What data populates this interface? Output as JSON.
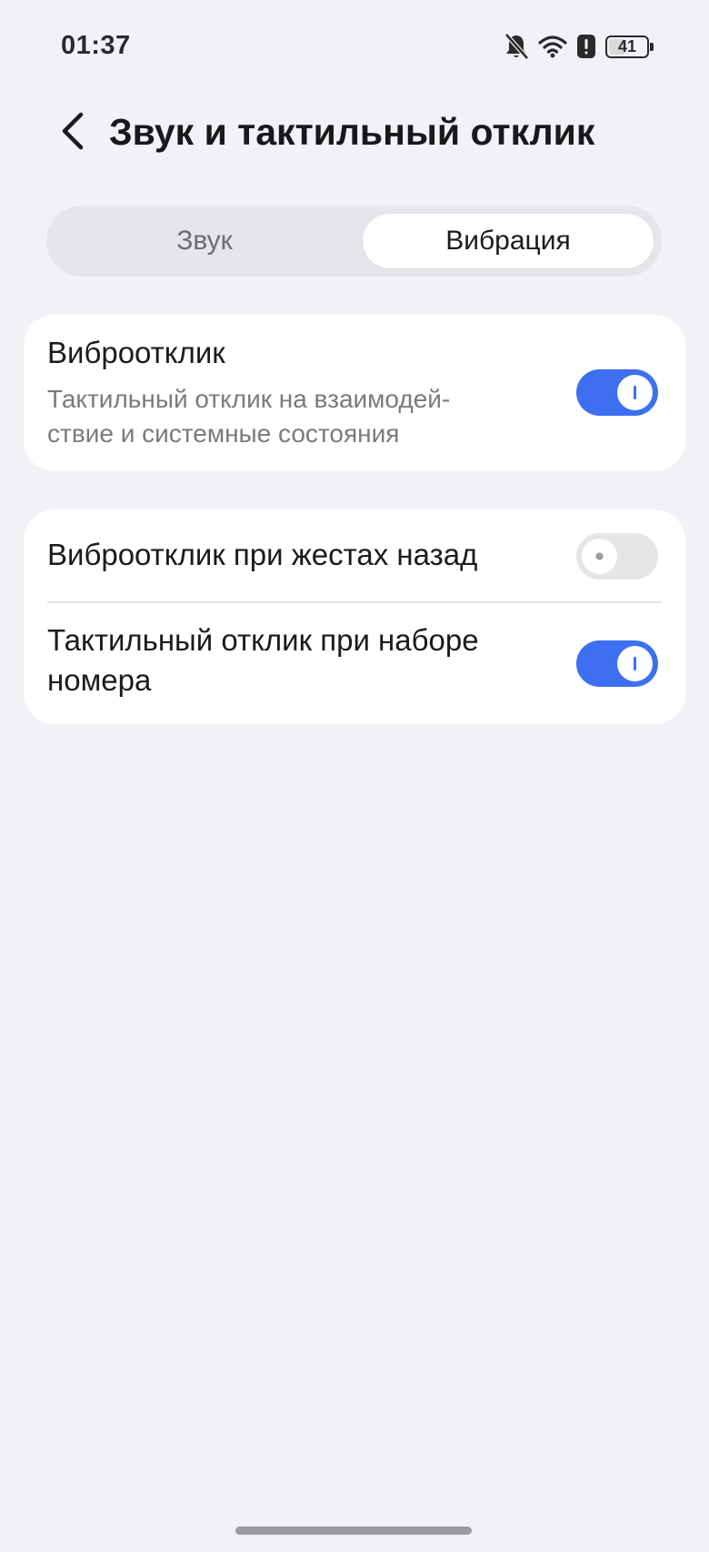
{
  "status_bar": {
    "time": "01:37",
    "battery_level": "41",
    "icons": [
      "bell-off-icon",
      "wifi-icon",
      "alert-icon",
      "battery-icon"
    ]
  },
  "header": {
    "title": "Звук и тактильный отклик",
    "back_icon": "chevron-left-icon"
  },
  "tabs": [
    {
      "label": "Звук",
      "selected": false
    },
    {
      "label": "Вибрация",
      "selected": true
    }
  ],
  "settings": {
    "haptic_feedback": {
      "title": "Виброотклик",
      "subtitle_line1": "Тактильный отклик на взаимодей-",
      "subtitle_line2": "ствие и системные состояния",
      "enabled": true
    },
    "back_gesture_haptic": {
      "title": "Виброотклик при жестах назад",
      "enabled": false
    },
    "dialpad_haptic": {
      "title_line1": "Тактильный отклик при наборе",
      "title_line2": "номера",
      "enabled": true
    }
  },
  "colors": {
    "accent": "#3d6ff0",
    "background": "#f1f2f6",
    "card": "#ffffff",
    "toggle_off": "#e6e6e9"
  }
}
